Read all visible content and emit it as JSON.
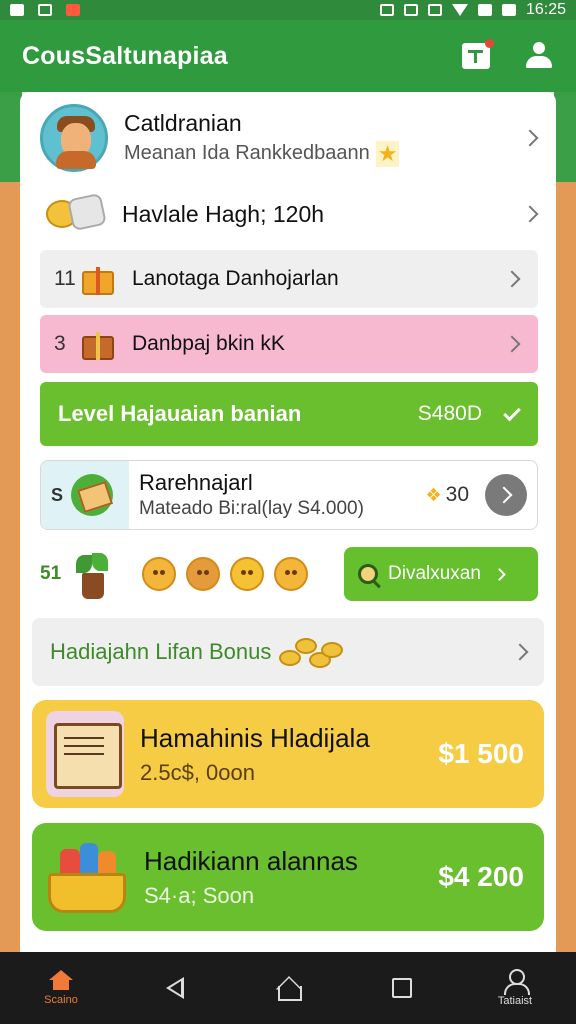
{
  "status_bar": {
    "time": "16:25"
  },
  "app_bar": {
    "title": "CousSaltunapiaa"
  },
  "profile": {
    "name": "Catldranian",
    "subtitle": "Meanan Ida Rankkedbaann"
  },
  "high": {
    "label": "Havlale Hagh; 120h"
  },
  "gray_row": {
    "num": "11",
    "label": "Lanotaga Danhojarlan"
  },
  "pink_row": {
    "num": "3",
    "label": "Danbpaj bkin kK"
  },
  "level": {
    "label": "Level Hajauaian banian",
    "value": "S480D"
  },
  "reward": {
    "prefix": "S",
    "title": "Rarehnajarl",
    "subtitle": "Mateado Bi:ral(lay S4.000)",
    "amount": "30"
  },
  "emoji_row": {
    "num": "51",
    "button_label": "Divalxuxan"
  },
  "bonus": {
    "label": "Hadiajahn Lifan Bonus"
  },
  "card_yellow": {
    "title": "Hamahinis Hladijala",
    "subtitle": "2.5c$, 0oon",
    "amount": "$1 500"
  },
  "card_green": {
    "title": "Hadikiann alannas",
    "subtitle": "S4·a; Soon",
    "amount": "$4 200"
  },
  "nav": {
    "home_label": "Scaino",
    "profile_label": "Tatiaist"
  },
  "colors": {
    "primary_green": "#2f9a3e",
    "accent_green": "#6abf2e",
    "yellow": "#f7cc45",
    "pink": "#f6b9cf",
    "active_nav": "#f07a3a"
  }
}
